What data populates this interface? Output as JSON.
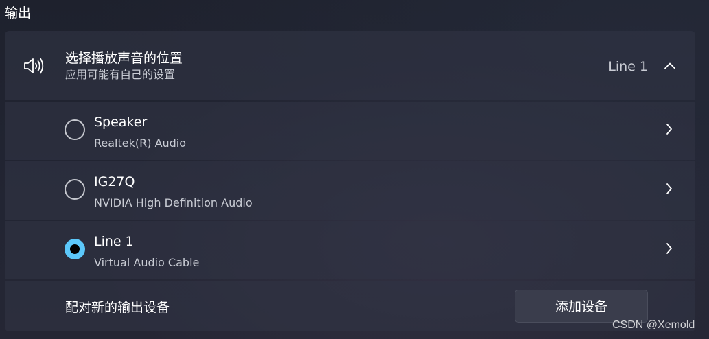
{
  "section_title": "输出",
  "output_location": {
    "title": "选择播放声音的位置",
    "subtitle": "应用可能有自己的设置",
    "selected_device": "Line 1",
    "expanded": true
  },
  "devices": [
    {
      "name": "Speaker",
      "description": "Realtek(R) Audio",
      "selected": false
    },
    {
      "name": "IG27Q",
      "description": "NVIDIA High Definition Audio",
      "selected": false
    },
    {
      "name": "Line 1",
      "description": "Virtual Audio Cable",
      "selected": true
    }
  ],
  "pair_new": {
    "label": "配对新的输出设备",
    "button_label": "添加设备"
  },
  "watermark": "CSDN @Xemold",
  "icons": {
    "header": "speaker-icon",
    "collapse": "chevron-up-icon",
    "row": "chevron-right-icon"
  },
  "colors": {
    "accent": "#5cc8fa",
    "card": "#2f3344",
    "text_secondary": "#c9ccd4"
  }
}
